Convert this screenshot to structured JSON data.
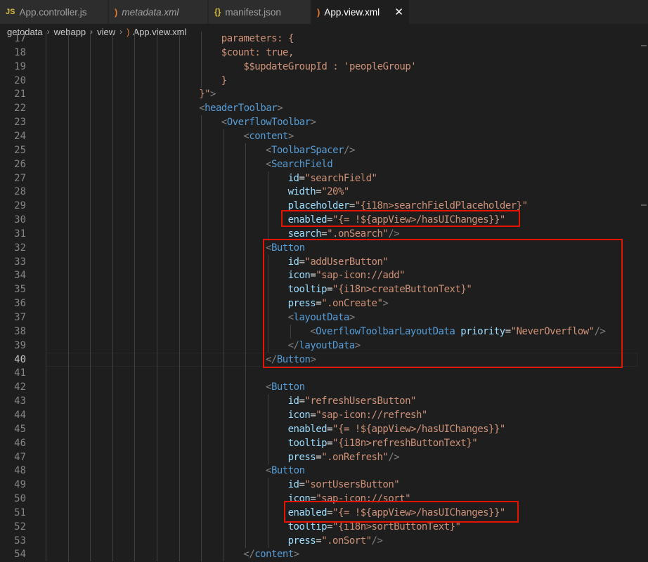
{
  "tabs": [
    {
      "icon": "JS",
      "icon_name": "javascript-file-icon",
      "label": "App.controller.js",
      "active": false,
      "italic": false
    },
    {
      "icon": ")",
      "icon_name": "xml-file-icon",
      "label": "metadata.xml",
      "active": false,
      "italic": true
    },
    {
      "icon": "{}",
      "icon_name": "json-file-icon",
      "label": "manifest.json",
      "active": false,
      "italic": false
    },
    {
      "icon": ")",
      "icon_name": "xml-file-icon",
      "label": "App.view.xml",
      "active": true,
      "italic": false
    }
  ],
  "close_icon": "✕",
  "breadcrumb": [
    "getodata",
    "webapp",
    "view",
    "App.view.xml"
  ],
  "current_line": 40,
  "lines": [
    {
      "n": 17,
      "segs": [
        [
          "t-str",
          "parameters: {"
        ]
      ]
    },
    {
      "n": 18,
      "segs": [
        [
          "t-str",
          "$count: true,"
        ]
      ]
    },
    {
      "n": 19,
      "segs": [
        [
          "t-str",
          "$$updateGroupId : 'peopleGroup'"
        ]
      ]
    },
    {
      "n": 20,
      "segs": [
        [
          "t-str",
          "}"
        ]
      ]
    },
    {
      "n": 21,
      "segs": [
        [
          "t-str",
          "}\""
        ],
        [
          "t-punc",
          ">"
        ]
      ]
    },
    {
      "n": 22,
      "segs": [
        [
          "t-punc",
          "<"
        ],
        [
          "t-tag",
          "headerToolbar"
        ],
        [
          "t-punc",
          ">"
        ]
      ]
    },
    {
      "n": 23,
      "segs": [
        [
          "t-punc",
          "<"
        ],
        [
          "t-tag",
          "OverflowToolbar"
        ],
        [
          "t-punc",
          ">"
        ]
      ]
    },
    {
      "n": 24,
      "segs": [
        [
          "t-punc",
          "<"
        ],
        [
          "t-tag",
          "content"
        ],
        [
          "t-punc",
          ">"
        ]
      ]
    },
    {
      "n": 25,
      "segs": [
        [
          "t-punc",
          "<"
        ],
        [
          "t-tag",
          "ToolbarSpacer"
        ],
        [
          "t-punc",
          "/>"
        ]
      ]
    },
    {
      "n": 26,
      "segs": [
        [
          "t-punc",
          "<"
        ],
        [
          "t-tag",
          "SearchField"
        ]
      ]
    },
    {
      "n": 27,
      "segs": [
        [
          "t-attr",
          "id"
        ],
        [
          "t-plain",
          "="
        ],
        [
          "t-str",
          "\"searchField\""
        ]
      ]
    },
    {
      "n": 28,
      "segs": [
        [
          "t-attr",
          "width"
        ],
        [
          "t-plain",
          "="
        ],
        [
          "t-str",
          "\"20%\""
        ]
      ]
    },
    {
      "n": 29,
      "segs": [
        [
          "t-attr",
          "placeholder"
        ],
        [
          "t-plain",
          "="
        ],
        [
          "t-str",
          "\"{i18n>searchFieldPlaceholder}\""
        ]
      ]
    },
    {
      "n": 30,
      "segs": [
        [
          "t-attr",
          "enabled"
        ],
        [
          "t-plain",
          "="
        ],
        [
          "t-str",
          "\"{= !${appView>/hasUIChanges}}\""
        ]
      ]
    },
    {
      "n": 31,
      "segs": [
        [
          "t-attr",
          "search"
        ],
        [
          "t-plain",
          "="
        ],
        [
          "t-str",
          "\".onSearch\""
        ],
        [
          "t-punc",
          "/>"
        ]
      ]
    },
    {
      "n": 32,
      "segs": [
        [
          "t-punc",
          "<"
        ],
        [
          "t-tag",
          "Button"
        ]
      ]
    },
    {
      "n": 33,
      "segs": [
        [
          "t-attr",
          "id"
        ],
        [
          "t-plain",
          "="
        ],
        [
          "t-str",
          "\"addUserButton\""
        ]
      ]
    },
    {
      "n": 34,
      "segs": [
        [
          "t-attr",
          "icon"
        ],
        [
          "t-plain",
          "="
        ],
        [
          "t-str",
          "\"sap-icon://add\""
        ]
      ]
    },
    {
      "n": 35,
      "segs": [
        [
          "t-attr",
          "tooltip"
        ],
        [
          "t-plain",
          "="
        ],
        [
          "t-str",
          "\"{i18n>createButtonText}\""
        ]
      ]
    },
    {
      "n": 36,
      "segs": [
        [
          "t-attr",
          "press"
        ],
        [
          "t-plain",
          "="
        ],
        [
          "t-str",
          "\".onCreate\""
        ],
        [
          "t-punc",
          ">"
        ]
      ]
    },
    {
      "n": 37,
      "segs": [
        [
          "t-punc",
          "<"
        ],
        [
          "t-tag",
          "layoutData"
        ],
        [
          "t-punc",
          ">"
        ]
      ]
    },
    {
      "n": 38,
      "segs": [
        [
          "t-punc",
          "<"
        ],
        [
          "t-tag",
          "OverflowToolbarLayoutData"
        ],
        [
          "t-plain",
          " "
        ],
        [
          "t-attr",
          "priority"
        ],
        [
          "t-plain",
          "="
        ],
        [
          "t-str",
          "\"NeverOverflow\""
        ],
        [
          "t-punc",
          "/>"
        ]
      ]
    },
    {
      "n": 39,
      "segs": [
        [
          "t-punc",
          "</"
        ],
        [
          "t-tag",
          "layoutData"
        ],
        [
          "t-punc",
          ">"
        ]
      ]
    },
    {
      "n": 40,
      "segs": [
        [
          "t-punc",
          "</"
        ],
        [
          "t-tag",
          "Button"
        ],
        [
          "t-punc",
          ">"
        ]
      ]
    },
    {
      "n": 41,
      "segs": []
    },
    {
      "n": 42,
      "segs": [
        [
          "t-punc",
          "<"
        ],
        [
          "t-tag",
          "Button"
        ]
      ]
    },
    {
      "n": 43,
      "segs": [
        [
          "t-attr",
          "id"
        ],
        [
          "t-plain",
          "="
        ],
        [
          "t-str",
          "\"refreshUsersButton\""
        ]
      ]
    },
    {
      "n": 44,
      "segs": [
        [
          "t-attr",
          "icon"
        ],
        [
          "t-plain",
          "="
        ],
        [
          "t-str",
          "\"sap-icon://refresh\""
        ]
      ]
    },
    {
      "n": 45,
      "segs": [
        [
          "t-attr",
          "enabled"
        ],
        [
          "t-plain",
          "="
        ],
        [
          "t-str",
          "\"{= !${appView>/hasUIChanges}}\""
        ]
      ]
    },
    {
      "n": 46,
      "segs": [
        [
          "t-attr",
          "tooltip"
        ],
        [
          "t-plain",
          "="
        ],
        [
          "t-str",
          "\"{i18n>refreshButtonText}\""
        ]
      ]
    },
    {
      "n": 47,
      "segs": [
        [
          "t-attr",
          "press"
        ],
        [
          "t-plain",
          "="
        ],
        [
          "t-str",
          "\".onRefresh\""
        ],
        [
          "t-punc",
          "/>"
        ]
      ]
    },
    {
      "n": 48,
      "segs": [
        [
          "t-punc",
          "<"
        ],
        [
          "t-tag",
          "Button"
        ]
      ]
    },
    {
      "n": 49,
      "segs": [
        [
          "t-attr",
          "id"
        ],
        [
          "t-plain",
          "="
        ],
        [
          "t-str",
          "\"sortUsersButton\""
        ]
      ]
    },
    {
      "n": 50,
      "segs": [
        [
          "t-attr",
          "icon"
        ],
        [
          "t-plain",
          "="
        ],
        [
          "t-str",
          "\"sap-icon://sort\""
        ]
      ]
    },
    {
      "n": 51,
      "segs": [
        [
          "t-attr",
          "enabled"
        ],
        [
          "t-plain",
          "="
        ],
        [
          "t-str",
          "\"{= !${appView>/hasUIChanges}}\""
        ]
      ]
    },
    {
      "n": 52,
      "segs": [
        [
          "t-attr",
          "tooltip"
        ],
        [
          "t-plain",
          "="
        ],
        [
          "t-str",
          "\"{i18n>sortButtonText}\""
        ]
      ]
    },
    {
      "n": 53,
      "segs": [
        [
          "t-attr",
          "press"
        ],
        [
          "t-plain",
          "="
        ],
        [
          "t-str",
          "\".onSort\""
        ],
        [
          "t-punc",
          "/>"
        ]
      ]
    },
    {
      "n": 54,
      "segs": [
        [
          "t-punc",
          "</"
        ],
        [
          "t-tag",
          "content"
        ],
        [
          "t-punc",
          ">"
        ]
      ]
    }
  ]
}
